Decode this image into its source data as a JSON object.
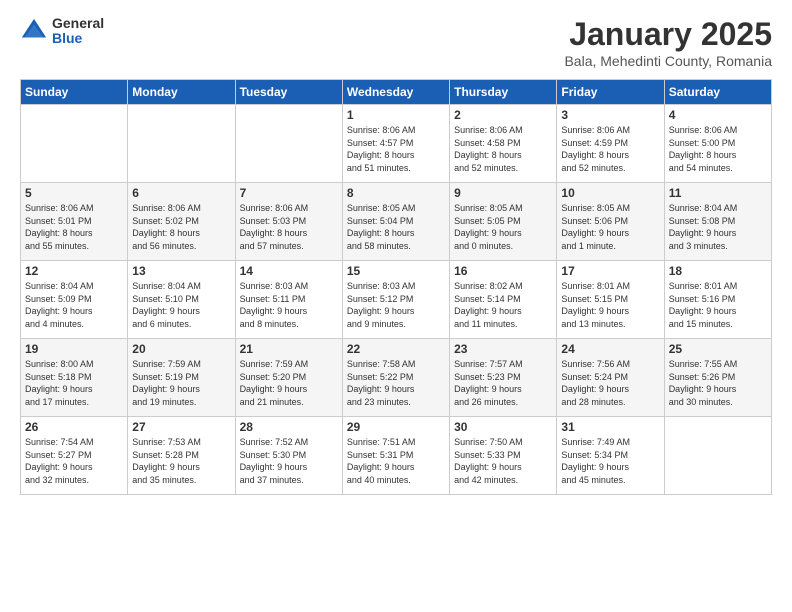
{
  "logo": {
    "general": "General",
    "blue": "Blue"
  },
  "header": {
    "month": "January 2025",
    "location": "Bala, Mehedinti County, Romania"
  },
  "weekdays": [
    "Sunday",
    "Monday",
    "Tuesday",
    "Wednesday",
    "Thursday",
    "Friday",
    "Saturday"
  ],
  "weeks": [
    [
      {
        "day": "",
        "info": ""
      },
      {
        "day": "",
        "info": ""
      },
      {
        "day": "",
        "info": ""
      },
      {
        "day": "1",
        "info": "Sunrise: 8:06 AM\nSunset: 4:57 PM\nDaylight: 8 hours\nand 51 minutes."
      },
      {
        "day": "2",
        "info": "Sunrise: 8:06 AM\nSunset: 4:58 PM\nDaylight: 8 hours\nand 52 minutes."
      },
      {
        "day": "3",
        "info": "Sunrise: 8:06 AM\nSunset: 4:59 PM\nDaylight: 8 hours\nand 52 minutes."
      },
      {
        "day": "4",
        "info": "Sunrise: 8:06 AM\nSunset: 5:00 PM\nDaylight: 8 hours\nand 54 minutes."
      }
    ],
    [
      {
        "day": "5",
        "info": "Sunrise: 8:06 AM\nSunset: 5:01 PM\nDaylight: 8 hours\nand 55 minutes."
      },
      {
        "day": "6",
        "info": "Sunrise: 8:06 AM\nSunset: 5:02 PM\nDaylight: 8 hours\nand 56 minutes."
      },
      {
        "day": "7",
        "info": "Sunrise: 8:06 AM\nSunset: 5:03 PM\nDaylight: 8 hours\nand 57 minutes."
      },
      {
        "day": "8",
        "info": "Sunrise: 8:05 AM\nSunset: 5:04 PM\nDaylight: 8 hours\nand 58 minutes."
      },
      {
        "day": "9",
        "info": "Sunrise: 8:05 AM\nSunset: 5:05 PM\nDaylight: 9 hours\nand 0 minutes."
      },
      {
        "day": "10",
        "info": "Sunrise: 8:05 AM\nSunset: 5:06 PM\nDaylight: 9 hours\nand 1 minute."
      },
      {
        "day": "11",
        "info": "Sunrise: 8:04 AM\nSunset: 5:08 PM\nDaylight: 9 hours\nand 3 minutes."
      }
    ],
    [
      {
        "day": "12",
        "info": "Sunrise: 8:04 AM\nSunset: 5:09 PM\nDaylight: 9 hours\nand 4 minutes."
      },
      {
        "day": "13",
        "info": "Sunrise: 8:04 AM\nSunset: 5:10 PM\nDaylight: 9 hours\nand 6 minutes."
      },
      {
        "day": "14",
        "info": "Sunrise: 8:03 AM\nSunset: 5:11 PM\nDaylight: 9 hours\nand 8 minutes."
      },
      {
        "day": "15",
        "info": "Sunrise: 8:03 AM\nSunset: 5:12 PM\nDaylight: 9 hours\nand 9 minutes."
      },
      {
        "day": "16",
        "info": "Sunrise: 8:02 AM\nSunset: 5:14 PM\nDaylight: 9 hours\nand 11 minutes."
      },
      {
        "day": "17",
        "info": "Sunrise: 8:01 AM\nSunset: 5:15 PM\nDaylight: 9 hours\nand 13 minutes."
      },
      {
        "day": "18",
        "info": "Sunrise: 8:01 AM\nSunset: 5:16 PM\nDaylight: 9 hours\nand 15 minutes."
      }
    ],
    [
      {
        "day": "19",
        "info": "Sunrise: 8:00 AM\nSunset: 5:18 PM\nDaylight: 9 hours\nand 17 minutes."
      },
      {
        "day": "20",
        "info": "Sunrise: 7:59 AM\nSunset: 5:19 PM\nDaylight: 9 hours\nand 19 minutes."
      },
      {
        "day": "21",
        "info": "Sunrise: 7:59 AM\nSunset: 5:20 PM\nDaylight: 9 hours\nand 21 minutes."
      },
      {
        "day": "22",
        "info": "Sunrise: 7:58 AM\nSunset: 5:22 PM\nDaylight: 9 hours\nand 23 minutes."
      },
      {
        "day": "23",
        "info": "Sunrise: 7:57 AM\nSunset: 5:23 PM\nDaylight: 9 hours\nand 26 minutes."
      },
      {
        "day": "24",
        "info": "Sunrise: 7:56 AM\nSunset: 5:24 PM\nDaylight: 9 hours\nand 28 minutes."
      },
      {
        "day": "25",
        "info": "Sunrise: 7:55 AM\nSunset: 5:26 PM\nDaylight: 9 hours\nand 30 minutes."
      }
    ],
    [
      {
        "day": "26",
        "info": "Sunrise: 7:54 AM\nSunset: 5:27 PM\nDaylight: 9 hours\nand 32 minutes."
      },
      {
        "day": "27",
        "info": "Sunrise: 7:53 AM\nSunset: 5:28 PM\nDaylight: 9 hours\nand 35 minutes."
      },
      {
        "day": "28",
        "info": "Sunrise: 7:52 AM\nSunset: 5:30 PM\nDaylight: 9 hours\nand 37 minutes."
      },
      {
        "day": "29",
        "info": "Sunrise: 7:51 AM\nSunset: 5:31 PM\nDaylight: 9 hours\nand 40 minutes."
      },
      {
        "day": "30",
        "info": "Sunrise: 7:50 AM\nSunset: 5:33 PM\nDaylight: 9 hours\nand 42 minutes."
      },
      {
        "day": "31",
        "info": "Sunrise: 7:49 AM\nSunset: 5:34 PM\nDaylight: 9 hours\nand 45 minutes."
      },
      {
        "day": "",
        "info": ""
      }
    ]
  ]
}
